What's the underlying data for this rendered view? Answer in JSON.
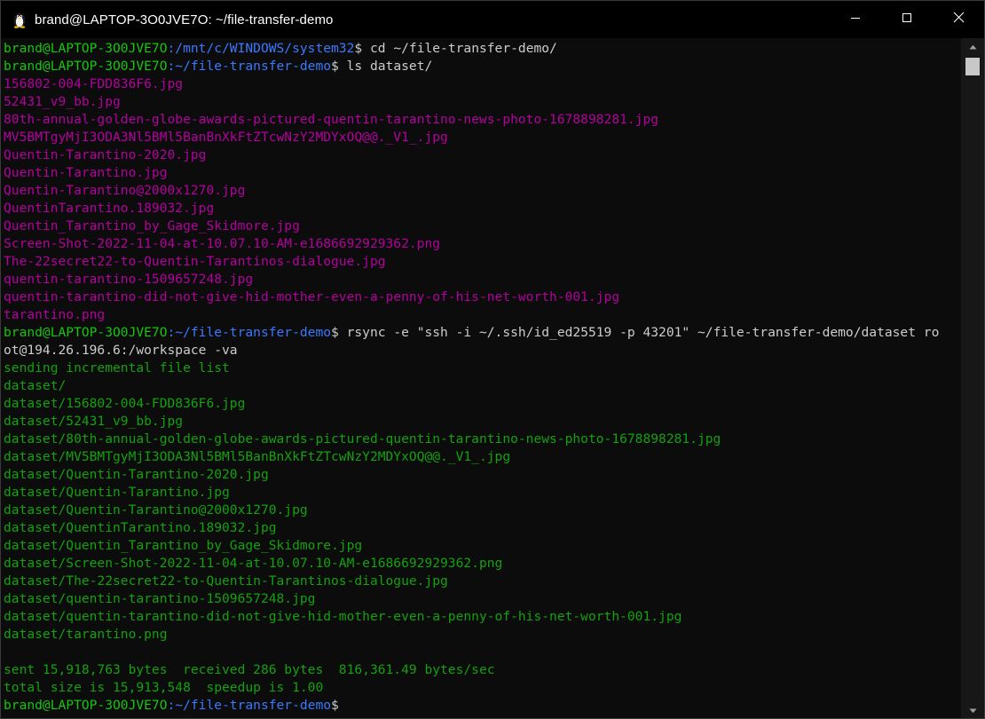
{
  "window": {
    "title": "brand@LAPTOP-3O0JVE7O: ~/file-transfer-demo",
    "app_icon": "linux-penguin-icon",
    "controls": {
      "minimize": "minimize-icon",
      "maximize": "maximize-icon",
      "close": "close-icon"
    }
  },
  "colors": {
    "background": "#0c0c0c",
    "prompt_user": "#16c60c",
    "prompt_path": "#3b78ff",
    "command_text": "#cccccc",
    "ls_files": "#b4009e",
    "rsync_output": "#13a10e"
  },
  "terminal": {
    "lines": [
      {
        "type": "prompt",
        "user": "brand@LAPTOP-3O0JVE7O",
        "path": ":/mnt/c/WINDOWS/system32",
        "command": " cd ~/file-transfer-demo/"
      },
      {
        "type": "prompt",
        "user": "brand@LAPTOP-3O0JVE7O",
        "path": ":~/file-transfer-demo",
        "command": " ls dataset/"
      },
      {
        "type": "file",
        "text": "156802-004-FDD836F6.jpg"
      },
      {
        "type": "file",
        "text": "52431_v9_bb.jpg"
      },
      {
        "type": "file",
        "text": "80th-annual-golden-globe-awards-pictured-quentin-tarantino-news-photo-1678898281.jpg"
      },
      {
        "type": "file",
        "text": "MV5BMTgyMjI3ODA3Nl5BMl5BanBnXkFtZTcwNzY2MDYxOQ@@._V1_.jpg"
      },
      {
        "type": "file",
        "text": "Quentin-Tarantino-2020.jpg"
      },
      {
        "type": "file",
        "text": "Quentin-Tarantino.jpg"
      },
      {
        "type": "file",
        "text": "Quentin-Tarantino@2000x1270.jpg"
      },
      {
        "type": "file",
        "text": "QuentinTarantino.189032.jpg"
      },
      {
        "type": "file",
        "text": "Quentin_Tarantino_by_Gage_Skidmore.jpg"
      },
      {
        "type": "file",
        "text": "Screen-Shot-2022-11-04-at-10.07.10-AM-e1686692929362.png"
      },
      {
        "type": "file",
        "text": "The-22secret22-to-Quentin-Tarantinos-dialogue.jpg"
      },
      {
        "type": "file",
        "text": "quentin-tarantino-1509657248.jpg"
      },
      {
        "type": "file",
        "text": "quentin-tarantino-did-not-give-hid-mother-even-a-penny-of-his-net-worth-001.jpg"
      },
      {
        "type": "file",
        "text": "tarantino.png"
      },
      {
        "type": "prompt",
        "user": "brand@LAPTOP-3O0JVE7O",
        "path": ":~/file-transfer-demo",
        "command": " rsync -e \"ssh -i ~/.ssh/id_ed25519 -p 43201\" ~/file-transfer-demo/dataset ro"
      },
      {
        "type": "cmd",
        "text": "ot@194.26.196.6:/workspace -va"
      },
      {
        "type": "out",
        "text": "sending incremental file list"
      },
      {
        "type": "out",
        "text": "dataset/"
      },
      {
        "type": "out",
        "text": "dataset/156802-004-FDD836F6.jpg"
      },
      {
        "type": "out",
        "text": "dataset/52431_v9_bb.jpg"
      },
      {
        "type": "out",
        "text": "dataset/80th-annual-golden-globe-awards-pictured-quentin-tarantino-news-photo-1678898281.jpg"
      },
      {
        "type": "out",
        "text": "dataset/MV5BMTgyMjI3ODA3Nl5BMl5BanBnXkFtZTcwNzY2MDYxOQ@@._V1_.jpg"
      },
      {
        "type": "out",
        "text": "dataset/Quentin-Tarantino-2020.jpg"
      },
      {
        "type": "out",
        "text": "dataset/Quentin-Tarantino.jpg"
      },
      {
        "type": "out",
        "text": "dataset/Quentin-Tarantino@2000x1270.jpg"
      },
      {
        "type": "out",
        "text": "dataset/QuentinTarantino.189032.jpg"
      },
      {
        "type": "out",
        "text": "dataset/Quentin_Tarantino_by_Gage_Skidmore.jpg"
      },
      {
        "type": "out",
        "text": "dataset/Screen-Shot-2022-11-04-at-10.07.10-AM-e1686692929362.png"
      },
      {
        "type": "out",
        "text": "dataset/The-22secret22-to-Quentin-Tarantinos-dialogue.jpg"
      },
      {
        "type": "out",
        "text": "dataset/quentin-tarantino-1509657248.jpg"
      },
      {
        "type": "out",
        "text": "dataset/quentin-tarantino-did-not-give-hid-mother-even-a-penny-of-his-net-worth-001.jpg"
      },
      {
        "type": "out",
        "text": "dataset/tarantino.png"
      },
      {
        "type": "out",
        "text": ""
      },
      {
        "type": "out",
        "text": "sent 15,918,763 bytes  received 286 bytes  816,361.49 bytes/sec"
      },
      {
        "type": "out",
        "text": "total size is 15,913,548  speedup is 1.00"
      },
      {
        "type": "prompt",
        "user": "brand@LAPTOP-3O0JVE7O",
        "path": ":~/file-transfer-demo",
        "command": ""
      }
    ]
  }
}
